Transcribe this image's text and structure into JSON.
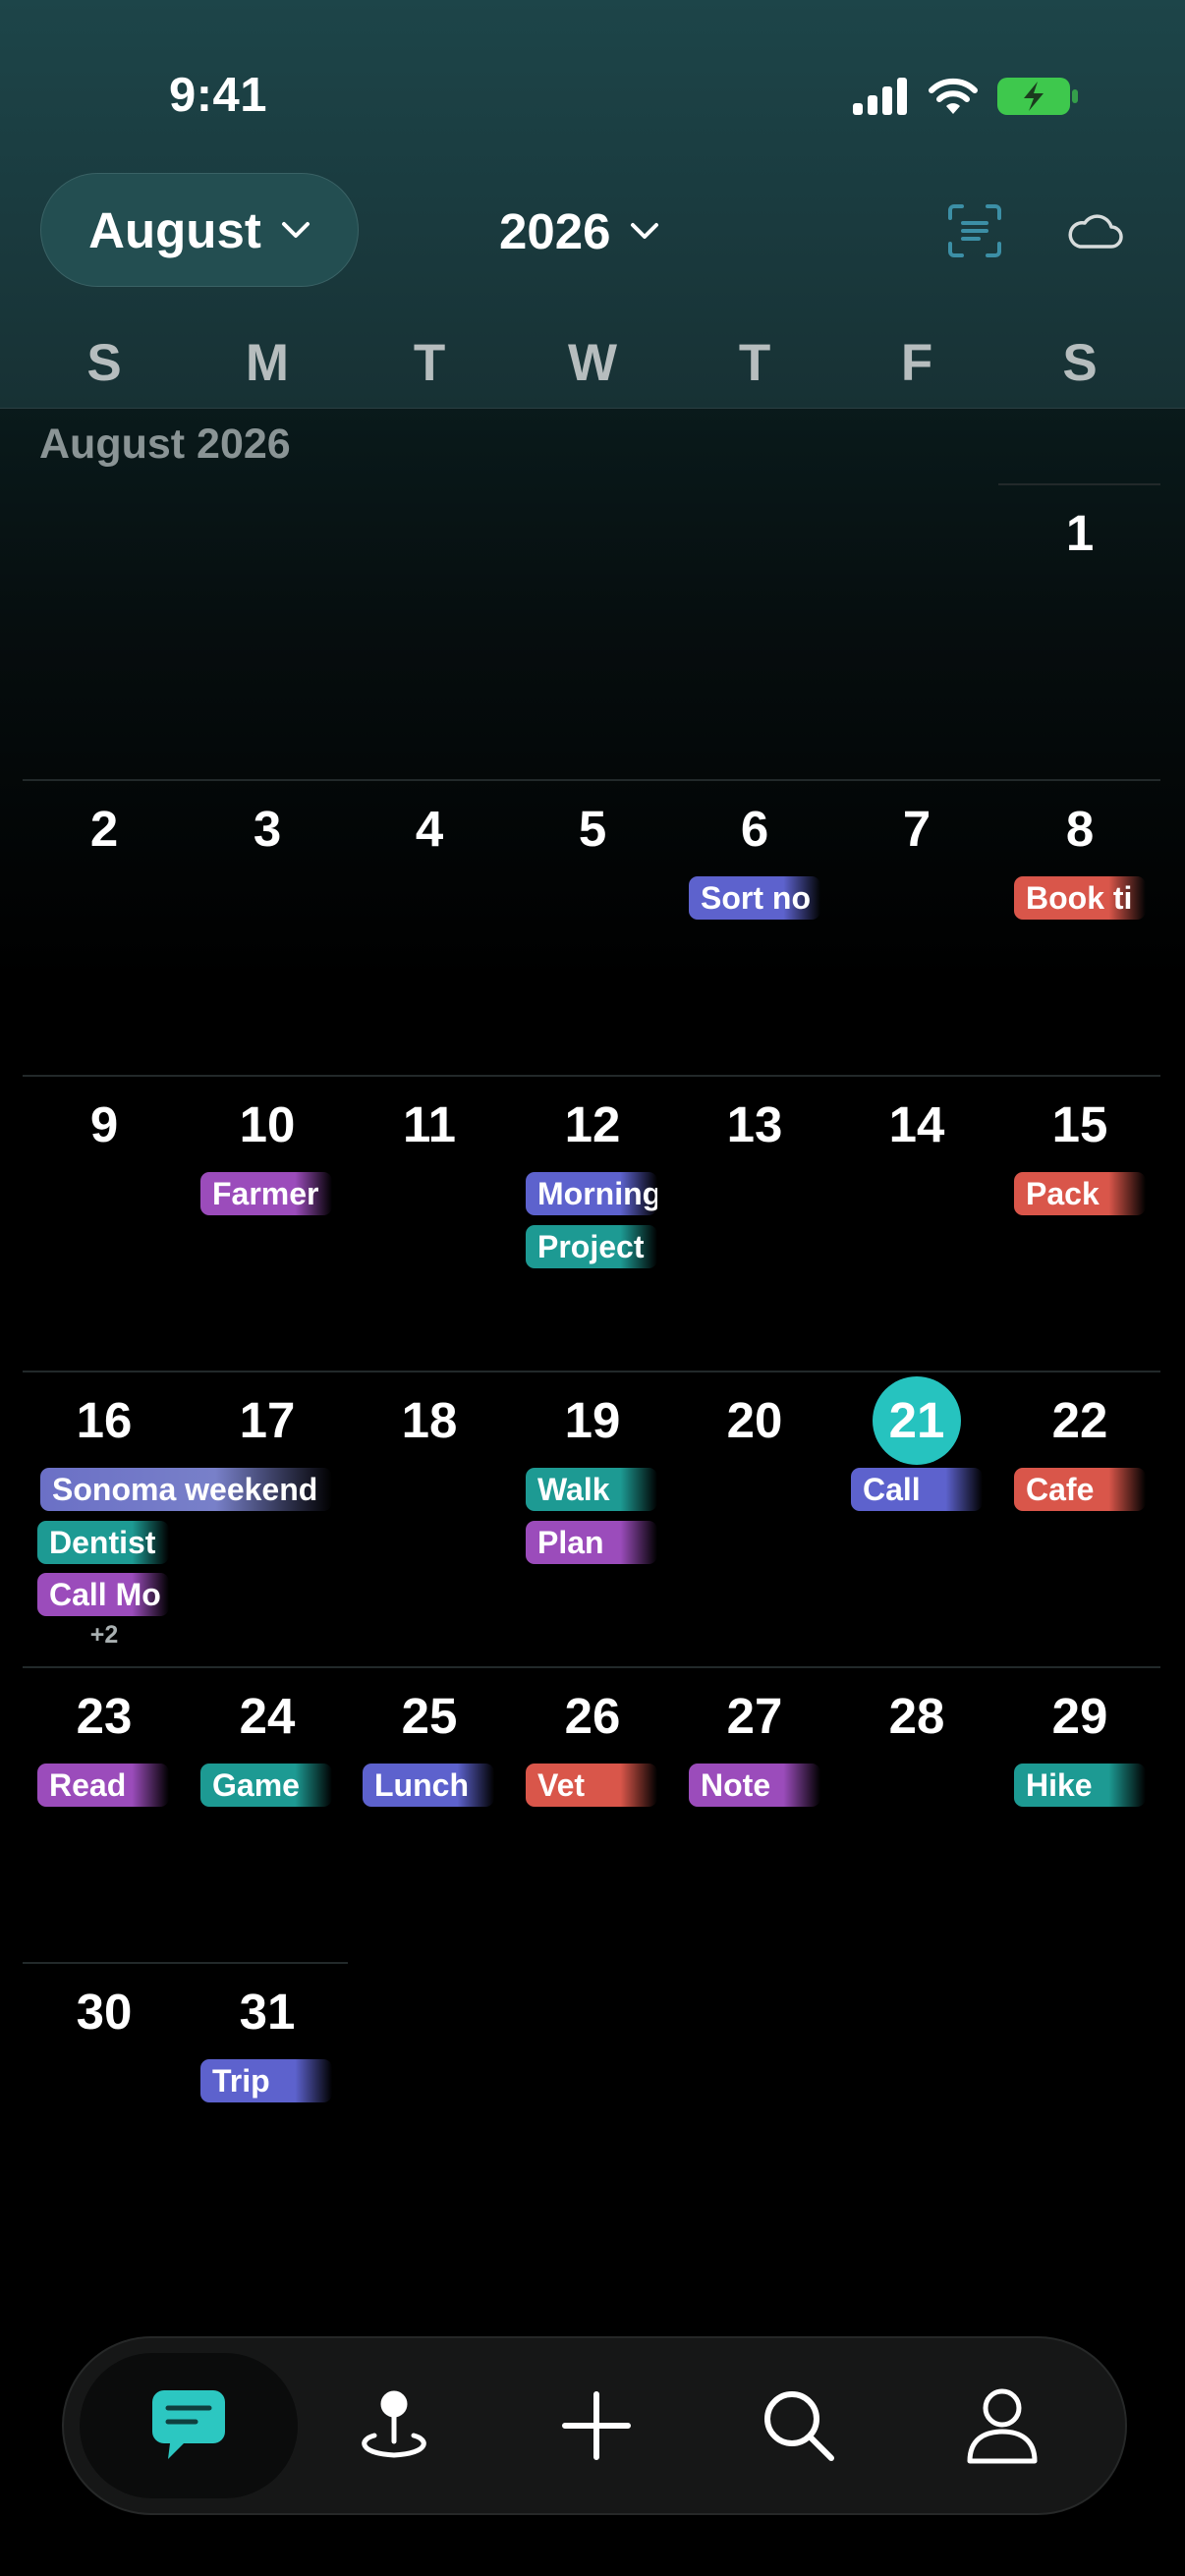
{
  "status_bar": {
    "time": "9:41"
  },
  "header": {
    "month_button": "August",
    "year_button": "2026",
    "weekdays": [
      "S",
      "M",
      "T",
      "W",
      "T",
      "F",
      "S"
    ]
  },
  "calendar": {
    "month_label": "August 2026",
    "today": "21",
    "days": {
      "1": "1",
      "2": "2",
      "3": "3",
      "4": "4",
      "5": "5",
      "6": "6",
      "7": "7",
      "8": "8",
      "9": "9",
      "10": "10",
      "11": "11",
      "12": "12",
      "13": "13",
      "14": "14",
      "15": "15",
      "16": "16",
      "17": "17",
      "18": "18",
      "19": "19",
      "20": "20",
      "21": "21",
      "22": "22",
      "23": "23",
      "24": "24",
      "25": "25",
      "26": "26",
      "27": "27",
      "28": "28",
      "29": "29",
      "30": "30",
      "31": "31"
    },
    "events": {
      "sort_no": "Sort no",
      "book_ti": "Book ti",
      "farmer": "Farmer",
      "morning": "Morning",
      "project": "Project",
      "pack": "Pack",
      "sonoma_weekend": "Sonoma weekend",
      "dentist": "Dentist",
      "call_mo": "Call Mo",
      "more_16": "+2",
      "walk": "Walk",
      "plan": "Plan",
      "call": "Call",
      "cafe": "Cafe",
      "read": "Read",
      "game": "Game",
      "lunch": "Lunch",
      "vet": "Vet",
      "note": "Note",
      "hike": "Hike",
      "trip": "Trip"
    },
    "colors": {
      "blue": "#5d62cd",
      "red": "#d9564a",
      "purple": "#9b4cbb",
      "teal": "#1d9a93",
      "today": "#26c3bf",
      "accent_icon": "#3c8fa6"
    }
  },
  "tab_bar": {
    "items": [
      "chat-icon",
      "location-pin-icon",
      "plus-icon",
      "search-icon",
      "profile-icon"
    ],
    "active": "chat-icon"
  }
}
